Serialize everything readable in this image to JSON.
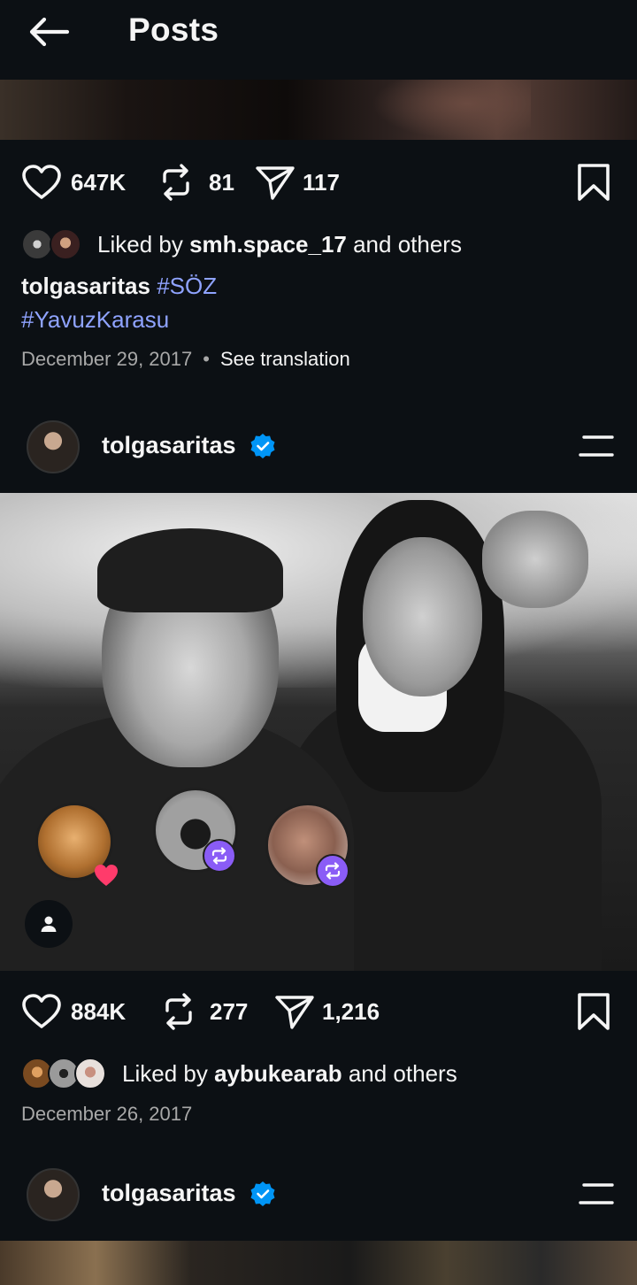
{
  "header": {
    "title": "Posts"
  },
  "post1": {
    "likes": "647K",
    "reposts": "81",
    "shares": "117",
    "liked_by_prefix": "Liked by ",
    "liked_by_user": "smh.space_17",
    "liked_by_suffix": " and others",
    "caption_user": "tolgasaritas",
    "hashtag1": "#SÖZ",
    "hashtag2": "#YavuzKarasu",
    "date": "December 29, 2017",
    "see_translation": "See translation"
  },
  "post2": {
    "username": "tolgasaritas",
    "likes": "884K",
    "reposts": "277",
    "shares": "1,216",
    "liked_by_prefix": "Liked by ",
    "liked_by_user": "aybukearab",
    "liked_by_suffix": " and others",
    "date": "December 26, 2017"
  },
  "post3": {
    "username": "tolgasaritas"
  },
  "icons": {
    "back": "arrow-left-icon",
    "like": "heart-icon",
    "repost": "repost-icon",
    "share": "send-icon",
    "save": "bookmark-icon",
    "verified": "verified-badge-icon",
    "menu": "menu-icon",
    "tag": "user-tag-icon"
  },
  "colors": {
    "background": "#0c1014",
    "hashtag": "#8fa3ff",
    "verified": "#0095f6",
    "repost_badge": "#8a5cf6"
  }
}
